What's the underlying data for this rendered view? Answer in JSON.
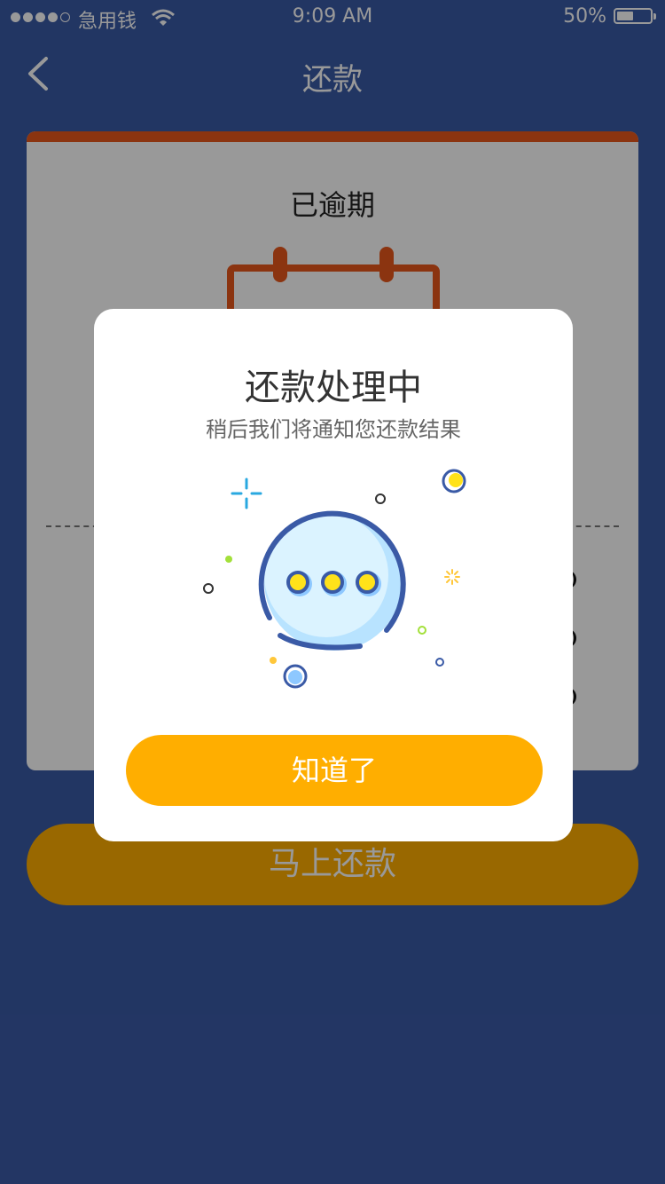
{
  "status_bar": {
    "carrier": "急用钱",
    "time": "9:09 AM",
    "battery": "50%",
    "battery_level": 0.5
  },
  "nav": {
    "title": "还款",
    "back_icon": "chevron-left-icon"
  },
  "card": {
    "state_label": "已逾期",
    "accent_color": "#e8581c"
  },
  "pay_button": {
    "label": "马上还款",
    "color": "#ffae00"
  },
  "dialog": {
    "title": "还款处理中",
    "subtitle": "稍后我们将通知您还款结果",
    "illustration_icon": "processing-chat-bubble-icon",
    "confirm_label": "知道了"
  }
}
